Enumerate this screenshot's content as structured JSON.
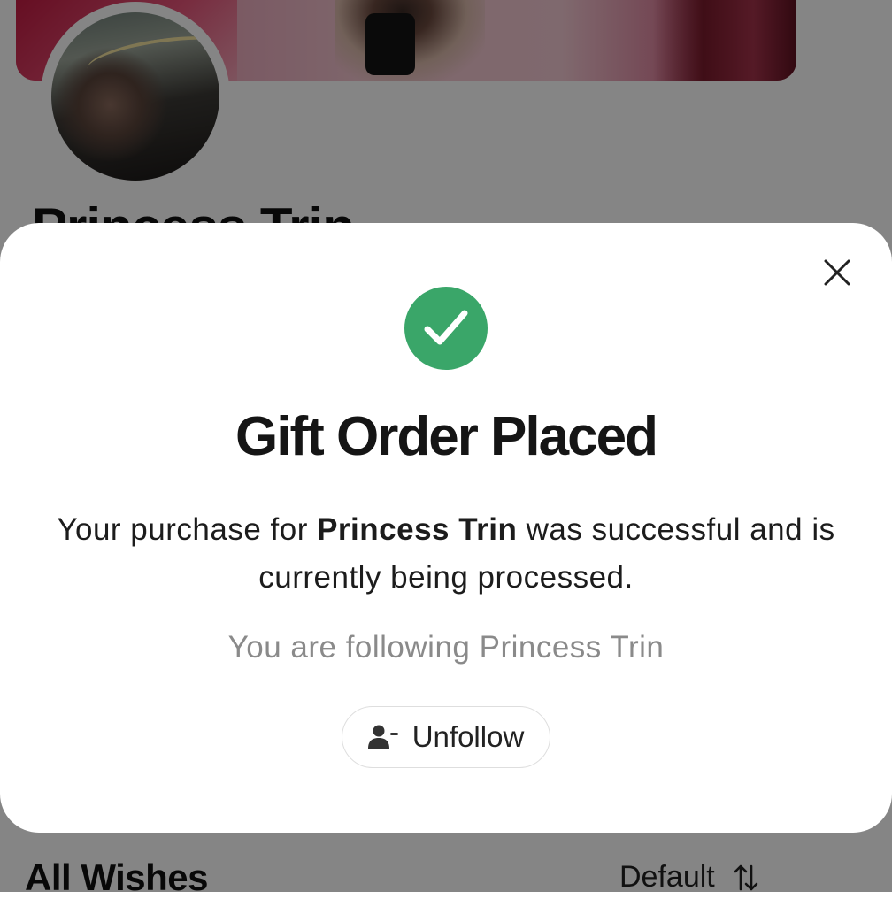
{
  "profile": {
    "name": "Princess Trin",
    "section_title": "All Wishes",
    "sort_label": "Default"
  },
  "modal": {
    "title": "Gift Order Placed",
    "message_prefix": "Your purchase for ",
    "message_name": "Princess Trin",
    "message_suffix": " was successful and is currently being processed.",
    "follow_status": "You are following Princess Trin",
    "unfollow_label": "Unfollow"
  },
  "icons": {
    "close": "close-icon",
    "success": "checkmark-icon",
    "unfollow": "user-minus-icon",
    "sort": "sort-arrows-icon"
  },
  "colors": {
    "success_green": "#3aa669",
    "overlay": "rgba(0,0,0,0.48)",
    "muted_text": "#8a8a8a"
  }
}
